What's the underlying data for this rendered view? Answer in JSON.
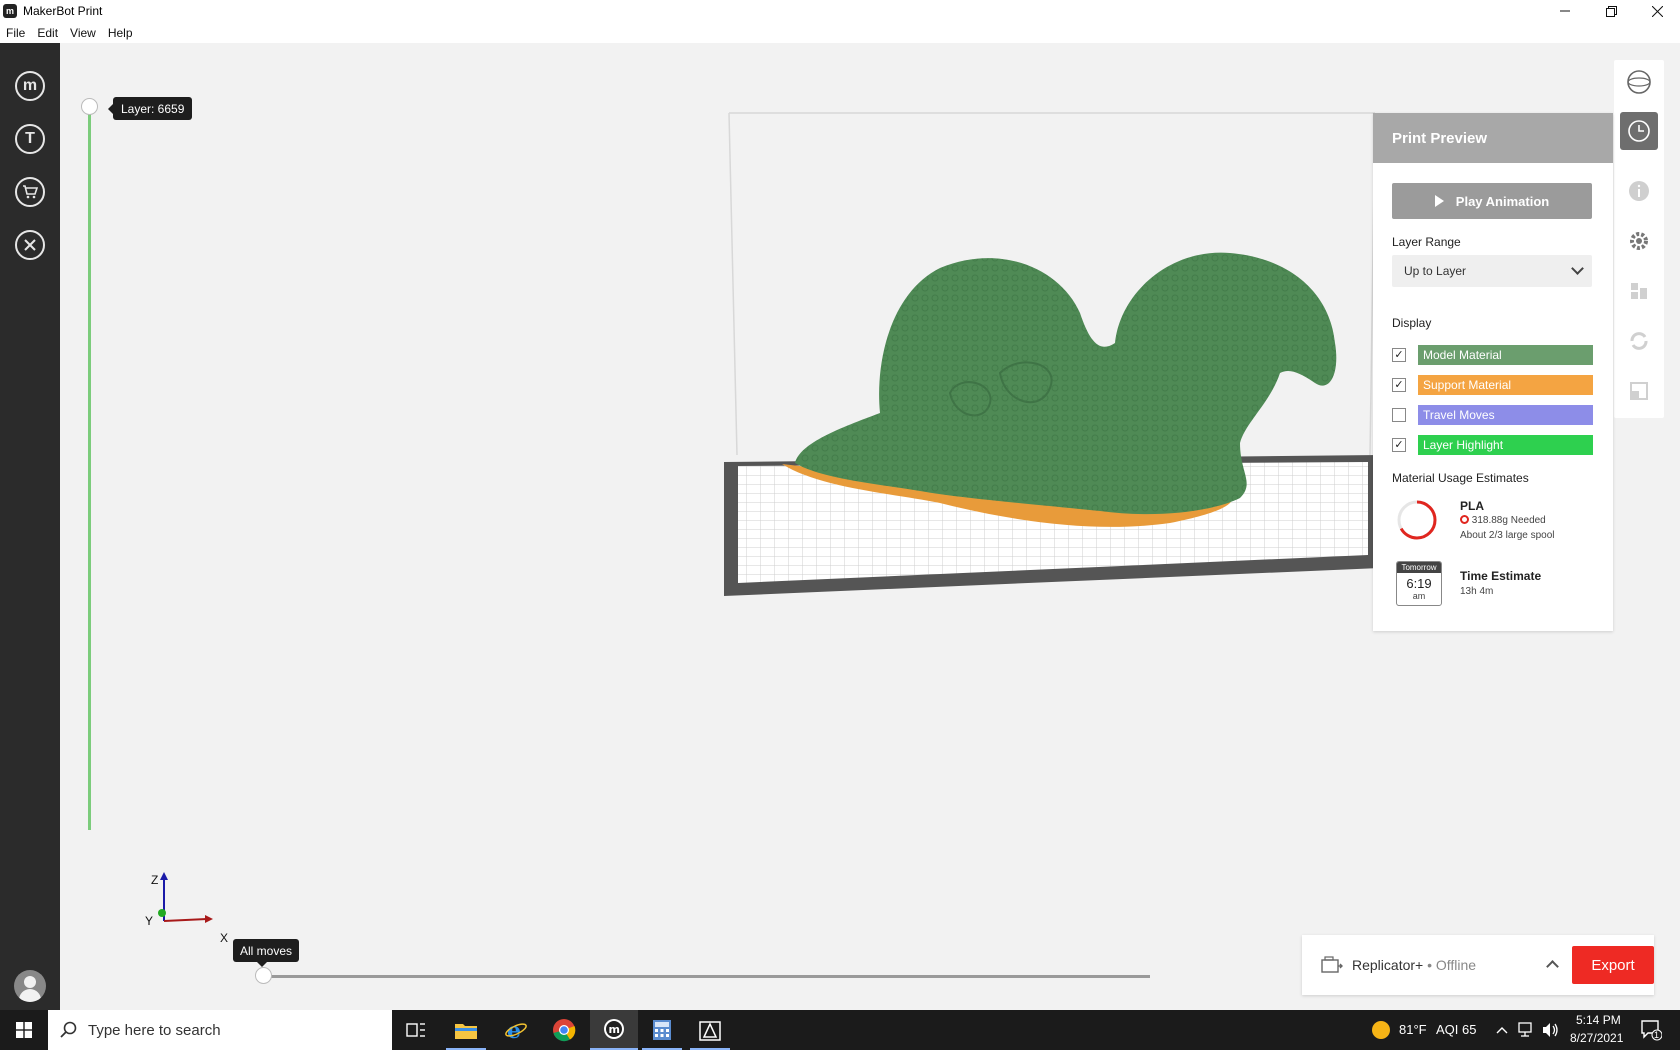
{
  "window": {
    "title": "MakerBot Print",
    "app_icon_glyph": "m"
  },
  "menu": [
    "File",
    "Edit",
    "View",
    "Help"
  ],
  "sidebar": {
    "items": [
      {
        "name": "makerbot-icon",
        "glyph": "m"
      },
      {
        "name": "thingiverse-icon",
        "glyph": "T"
      },
      {
        "name": "store-cart-icon",
        "glyph": ""
      },
      {
        "name": "tools-icon",
        "glyph": ""
      }
    ]
  },
  "viewport": {
    "layer_label": "Layer: 6659",
    "moves_label": "All moves",
    "axis": {
      "z": "Z",
      "y": "Y",
      "x": "X"
    },
    "colors": {
      "model": "#4f8a55",
      "support": "#e89b3a",
      "bed": "#555555"
    }
  },
  "preview_panel": {
    "title": "Print Preview",
    "play_label": "Play Animation",
    "layer_range_label": "Layer Range",
    "layer_range_value": "Up to Layer",
    "display_label": "Display",
    "display": [
      {
        "label": "Model Material",
        "checked": true,
        "color": "#6b9e6e"
      },
      {
        "label": "Support Material",
        "checked": true,
        "color": "#f4a442"
      },
      {
        "label": "Travel Moves",
        "checked": false,
        "color": "#8d8de8"
      },
      {
        "label": "Layer Highlight",
        "checked": true,
        "color": "#2ed04f"
      }
    ],
    "material_label": "Material Usage Estimates",
    "material": {
      "name": "PLA",
      "amount": "318.88g",
      "needed": "Needed",
      "note": "About 2/3 large spool",
      "fraction": 0.67
    },
    "time": {
      "title": "Time Estimate",
      "value": "13h 4m",
      "day": "Tomorrow",
      "clock": "6:19",
      "ampm": "am"
    }
  },
  "printer": {
    "name": "Replicator+",
    "status": "• Offline",
    "export_label": "Export"
  },
  "taskbar": {
    "search_placeholder": "Type here to search",
    "weather": "81°F",
    "aqi": "AQI 65",
    "time": "5:14 PM",
    "date": "8/27/2021",
    "notification_count": "1"
  }
}
